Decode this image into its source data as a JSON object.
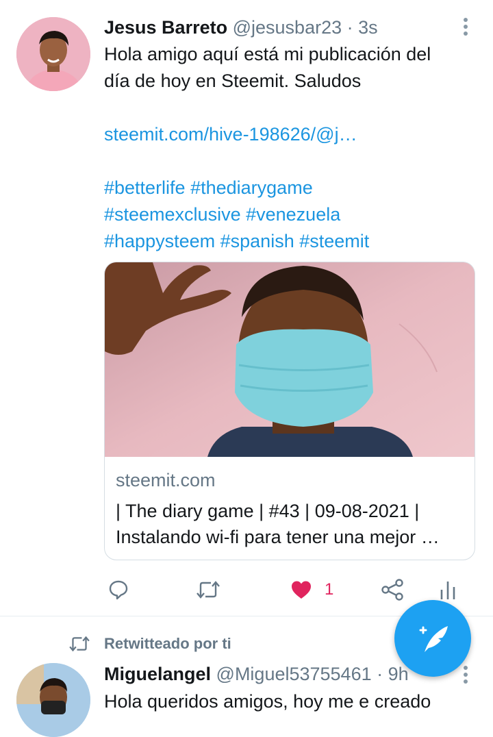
{
  "tweet": {
    "display_name": "Jesus Barreto",
    "handle": "@jesusbar23",
    "separator": " · ",
    "time": "3s",
    "text_line1": "Hola amigo aquí está mi publicación del",
    "text_line2": "día de hoy en Steemit. Saludos",
    "link": "steemit.com/hive-198626/@j…",
    "hashtags_line1": [
      "#betterlife",
      "#thediarygame"
    ],
    "hashtags_line2": [
      "#steemexclusive",
      "#venezuela"
    ],
    "hashtags_line3": [
      "#happysteem",
      "#spanish",
      "#steemit"
    ],
    "card": {
      "domain": "steemit.com",
      "title_line1": "| The diary game | #43 | 09-08-2021 |",
      "title_line2": "Instalando wi-fi para tener una mejor …"
    },
    "actions": {
      "like_count": "1",
      "icons": [
        "reply-icon",
        "retweet-icon",
        "heart-filled-icon",
        "share-icon",
        "analytics-icon"
      ]
    }
  },
  "retweet_context": {
    "label": "Retwitteado por ti"
  },
  "tweet2": {
    "display_name": "Miguelangel",
    "handle": "@Miguel53755461",
    "separator": " · ",
    "time": "9h",
    "text_partial": "Hola queridos amigos, hoy me e creado"
  },
  "colors": {
    "link": "#1b95e0",
    "secondary_text": "#657786",
    "like": "#e0245e",
    "fab": "#1da1f2"
  }
}
